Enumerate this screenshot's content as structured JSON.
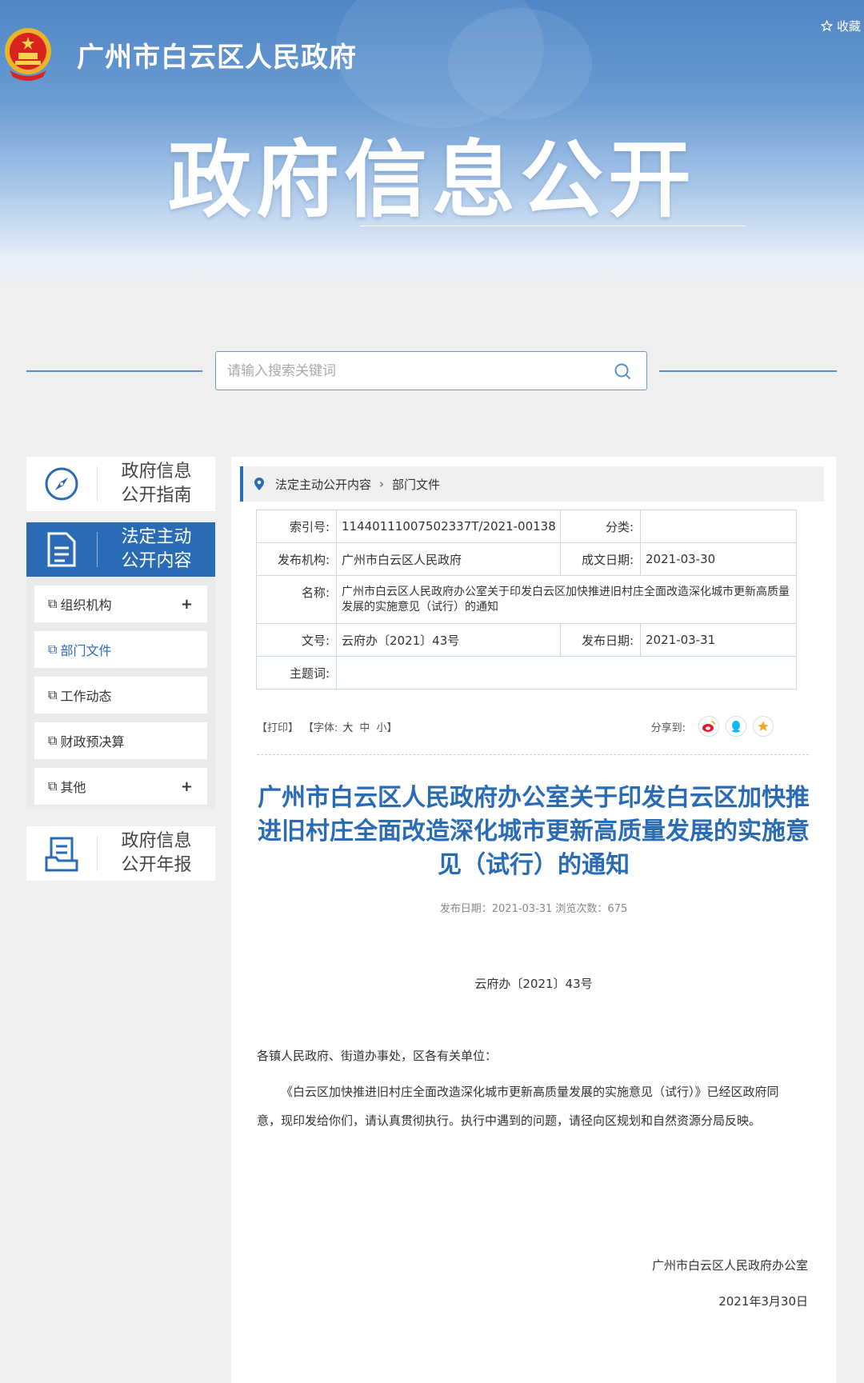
{
  "header": {
    "site_name": "广州市白云区人民政府",
    "favorite": "收藏",
    "banner_title": "政府信息公开"
  },
  "search": {
    "placeholder": "请输入搜索关键词"
  },
  "sidebar": {
    "guide": "政府信息\n公开指南",
    "content": "法定主动\n公开内容",
    "report": "政府信息\n公开年报",
    "items": [
      {
        "label": "组织机构",
        "expandable": true
      },
      {
        "label": "部门文件",
        "expandable": false,
        "current": true
      },
      {
        "label": "工作动态",
        "expandable": false
      },
      {
        "label": "财政预决算",
        "expandable": false
      },
      {
        "label": "其他",
        "expandable": true
      }
    ]
  },
  "breadcrumb": [
    "法定主动公开内容",
    "部门文件"
  ],
  "meta": {
    "index_label": "索引号:",
    "index_value": "11440111007502337T/2021-00138",
    "category_label": "分类:",
    "category_value": "",
    "org_label": "发布机构:",
    "org_value": "广州市白云区人民政府",
    "created_label": "成文日期:",
    "created_value": "2021-03-30",
    "name_label": "名称:",
    "name_value": "广州市白云区人民政府办公室关于印发白云区加快推进旧村庄全面改造深化城市更新高质量发展的实施意见（试行）的通知",
    "docno_label": "文号:",
    "docno_value": "云府办〔2021〕43号",
    "published_label": "发布日期:",
    "published_value": "2021-03-31",
    "keywords_label": "主题词:",
    "keywords_value": ""
  },
  "toolbar": {
    "print": "【打印】",
    "font_prefix": "【字体:",
    "font_large": "大",
    "font_medium": "中",
    "font_small": "小】",
    "share_label": "分享到:"
  },
  "article": {
    "title": "广州市白云区人民政府办公室关于印发白云区加快推进旧村庄全面改造深化城市更新高质量发展的实施意见（试行）的通知",
    "info": "发布日期：2021-03-31  浏览次数：675",
    "doc_no": "云府办〔2021〕43号",
    "salutation": "各镇人民政府、街道办事处，区各有关单位：",
    "body": "《白云区加快推进旧村庄全面改造深化城市更新高质量发展的实施意见（试行）》已经区政府同意，现印发给你们，请认真贯彻执行。执行中遇到的问题，请径向区规划和自然资源分局反映。",
    "sign_org": "广州市白云区人民政府办公室",
    "sign_date": "2021年3月30日"
  },
  "colors": {
    "accent": "#2a6bb5",
    "title_blue": "#2a6bb5",
    "weibo": "#e6162d",
    "qq": "#12b7f5",
    "qzone": "#f5a623"
  }
}
